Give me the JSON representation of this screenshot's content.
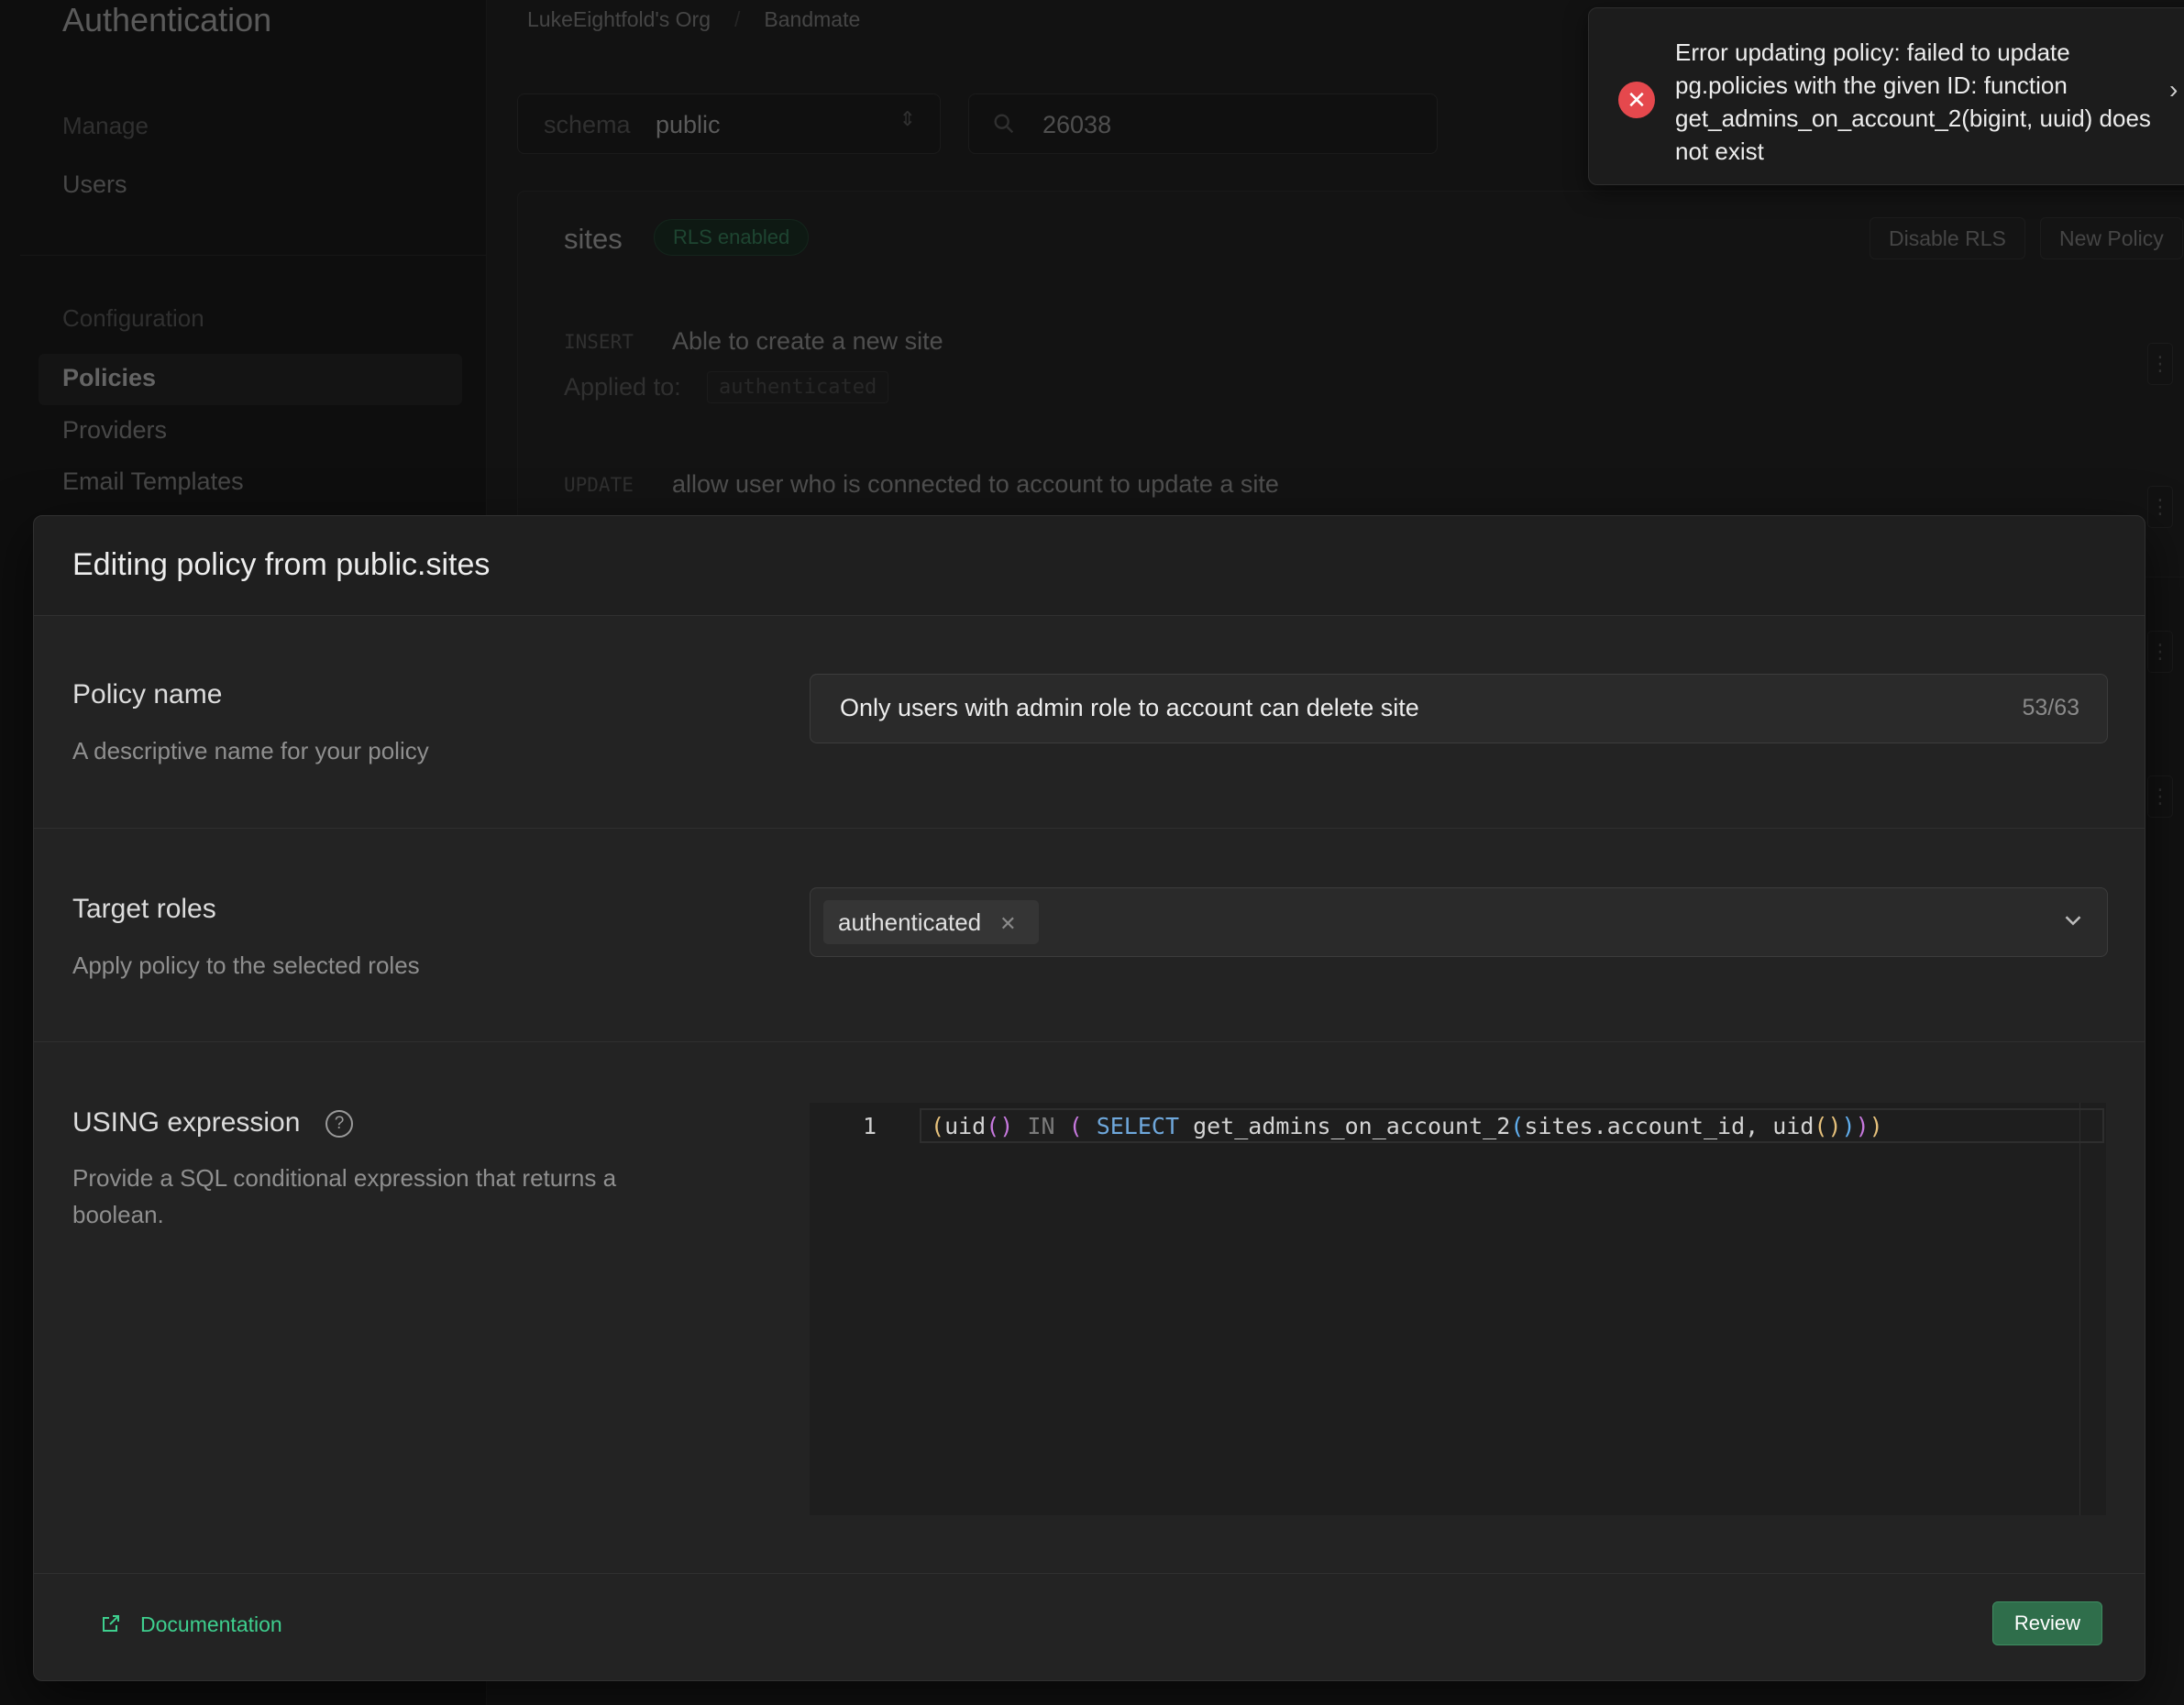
{
  "sidebar": {
    "title": "Authentication",
    "groups": [
      {
        "label": "Manage",
        "items": [
          "Users"
        ]
      },
      {
        "label": "Configuration",
        "items": [
          "Policies",
          "Providers",
          "Email Templates"
        ]
      }
    ],
    "active_item": "Policies"
  },
  "breadcrumb": {
    "org": "LukeEightfold's Org",
    "project": "Bandmate"
  },
  "filters": {
    "schema_label": "schema",
    "schema_value": "public",
    "search_value": "26038"
  },
  "table": {
    "name": "sites",
    "badge": "RLS enabled",
    "disable_rls_label": "Disable RLS",
    "new_policy_label": "New Policy",
    "policies": [
      {
        "command": "INSERT",
        "name": "Able to create a new site",
        "applied_label": "Applied to:",
        "role": "authenticated"
      },
      {
        "command": "UPDATE",
        "name": "allow user who is connected to account to update a site"
      }
    ]
  },
  "toast": {
    "message": "Error updating policy: failed to update pg.policies with the given ID: function get_admins_on_account_2(bigint, uuid) does not exist",
    "icon": "error-x-icon"
  },
  "modal": {
    "title": "Editing policy from public.sites",
    "policy_name": {
      "label": "Policy name",
      "description": "A descriptive name for your policy",
      "value": "Only users with admin role to account can delete site",
      "counter": "53/63"
    },
    "target_roles": {
      "label": "Target roles",
      "description": "Apply policy to the selected roles",
      "selected": [
        "authenticated"
      ]
    },
    "using_expression": {
      "label": "USING expression",
      "description": "Provide a SQL conditional expression that returns a boolean.",
      "line_number": "1",
      "code": "(uid() IN ( SELECT get_admins_on_account_2(sites.account_id, uid())))"
    },
    "footer": {
      "documentation_label": "Documentation",
      "review_label": "Review"
    }
  },
  "colors": {
    "accent": "#3ecf8e",
    "error": "#e5484d",
    "review_button": "#2f6e4b"
  }
}
